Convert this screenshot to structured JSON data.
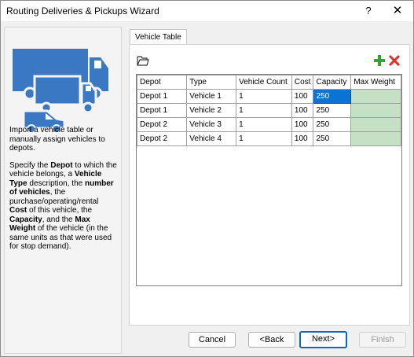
{
  "window": {
    "title": "Routing Deliveries & Pickups Wizard",
    "help_label": "?",
    "close_label": "✕"
  },
  "sidebar": {
    "intro": "Import a vehicle table or manually assign vehicles to depots.",
    "desc": [
      "Specify the ",
      "Depot",
      " to which the vehicle belongs, a ",
      "Vehicle Type",
      " description, the ",
      "number of vehicles",
      ", the purchase/operating/rental ",
      "Cost",
      " of this vehicle, the ",
      "Capacity",
      ", and the ",
      "Max Weight",
      " of the vehicle (in the same units as that were used for stop demand)."
    ]
  },
  "tabs": [
    {
      "label": "Vehicle Table"
    }
  ],
  "toolbar": {
    "open_icon": "folder-open-icon",
    "add_icon": "plus-icon",
    "delete_icon": "delete-x-icon"
  },
  "table": {
    "headers": [
      "Depot",
      "Type",
      "Vehicle Count",
      "Cost",
      "Capacity",
      "Max Weight"
    ],
    "rows": [
      [
        "Depot 1",
        "Vehicle 1",
        "1",
        "100",
        "250",
        ""
      ],
      [
        "Depot 1",
        "Vehicle 2",
        "1",
        "100",
        "250",
        ""
      ],
      [
        "Depot 2",
        "Vehicle 3",
        "1",
        "100",
        "250",
        ""
      ],
      [
        "Depot 2",
        "Vehicle 4",
        "1",
        "100",
        "250",
        ""
      ]
    ]
  },
  "buttons": {
    "cancel": "Cancel",
    "back": "<Back",
    "next": "Next>",
    "finish": "Finish"
  },
  "colors": {
    "selection": "#0a74d6",
    "max_weight_fill": "#c5e0c5",
    "add_green": "#2da82d",
    "delete_red": "#d9312b",
    "truck_blue": "#3b78c4"
  }
}
